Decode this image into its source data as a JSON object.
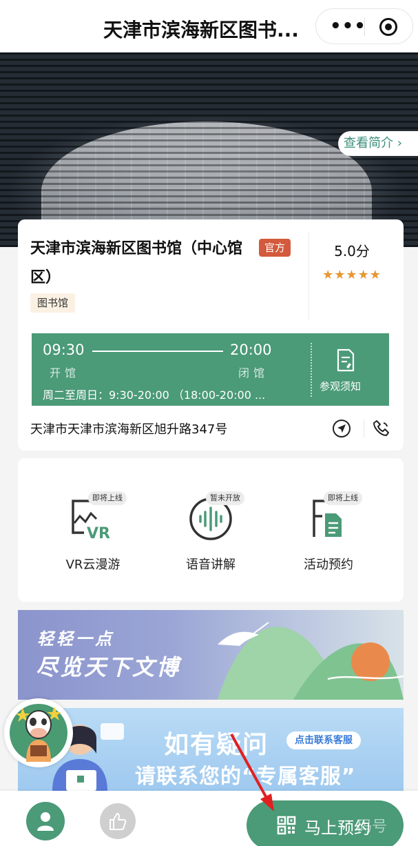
{
  "header": {
    "title": "天津市滨海新区图书...",
    "more_icon": "more-dots-icon",
    "close_icon": "target-icon"
  },
  "hero": {
    "intro_button": "查看简介 ›"
  },
  "library": {
    "name": "天津市滨海新区图书馆（中心馆区）",
    "official_badge": "官方",
    "category": "图书馆",
    "score": "5.0分",
    "stars": "★★★★★",
    "rating_value": 5
  },
  "hours": {
    "open_time": "09:30",
    "close_time": "20:00",
    "open_label": "开馆",
    "close_label": "闭馆",
    "detail": "周二至周日：9:30-20:00 （18:00-20:00 ...",
    "notice_label": "参观须知"
  },
  "address": {
    "text": "天津市天津市滨海新区旭升路347号",
    "nav_icon": "navigation-icon",
    "phone_icon": "phone-icon"
  },
  "features": [
    {
      "label": "VR云漫游",
      "badge": "即将上线",
      "icon": "vr-icon"
    },
    {
      "label": "语音讲解",
      "badge": "暂未开放",
      "icon": "audio-wave-icon"
    },
    {
      "label": "活动预约",
      "badge": "即将上线",
      "icon": "document-icon"
    }
  ],
  "banner1": {
    "line1": "轻轻一点",
    "line2": "尽览天下文博"
  },
  "banner2": {
    "line1": "如有疑问",
    "pill": "点击联系客服",
    "line2": "请联系您的“专属客服”"
  },
  "bottom": {
    "reserve_label": "马上预约",
    "watermark": "码号"
  },
  "colors": {
    "primary": "#4b9a78",
    "accent_orange": "#e8962d",
    "official_red": "#d35a3c",
    "arrow_red": "#e02020"
  }
}
